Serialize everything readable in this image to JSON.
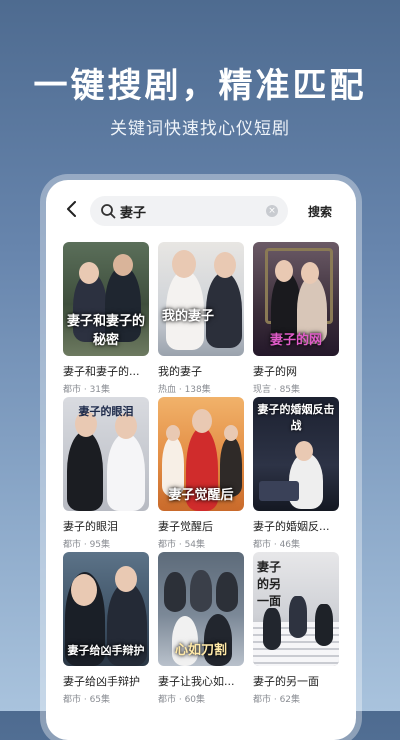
{
  "promo": {
    "headline": "一键搜剧，精准匹配",
    "subline": "关键词快速找心仪短剧"
  },
  "search": {
    "query": "妻子",
    "button_label": "搜索"
  },
  "results": [
    {
      "title": "妻子和妻子的...",
      "meta": "都市 · 31集",
      "poster_text": "妻子和妻子的秘密"
    },
    {
      "title": "我的妻子",
      "meta": "热血 · 138集",
      "poster_text": "我的妻子"
    },
    {
      "title": "妻子的网",
      "meta": "现言 · 85集",
      "poster_text": "妻子的网"
    },
    {
      "title": "妻子的眼泪",
      "meta": "都市 · 95集",
      "poster_text": "妻子的眼泪"
    },
    {
      "title": "妻子觉醒后",
      "meta": "都市 · 54集",
      "poster_text": "妻子觉醒后"
    },
    {
      "title": "妻子的婚姻反...",
      "meta": "都市 · 46集",
      "poster_text": "妻子的婚姻反击战"
    },
    {
      "title": "妻子给凶手辩护",
      "meta": "都市 · 65集",
      "poster_text": "妻子给凶手辩护"
    },
    {
      "title": "妻子让我心如...",
      "meta": "都市 · 60集",
      "poster_text": "心如刀割"
    },
    {
      "title": "妻子的另一面",
      "meta": "都市 · 62集",
      "poster_text": "妻子的另一面"
    }
  ]
}
